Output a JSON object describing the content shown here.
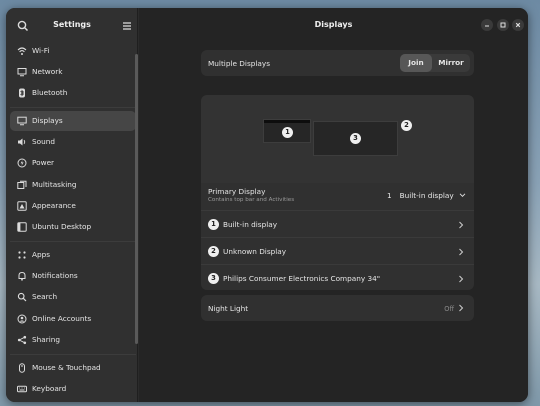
{
  "sidebar": {
    "title": "Settings",
    "items": [
      {
        "label": "Wi-Fi",
        "icon": "wifi-icon"
      },
      {
        "label": "Network",
        "icon": "network-icon"
      },
      {
        "label": "Bluetooth",
        "icon": "bluetooth-icon"
      },
      {
        "label": "Displays",
        "icon": "display-icon",
        "active": true
      },
      {
        "label": "Sound",
        "icon": "sound-icon"
      },
      {
        "label": "Power",
        "icon": "power-icon"
      },
      {
        "label": "Multitasking",
        "icon": "multitasking-icon"
      },
      {
        "label": "Appearance",
        "icon": "appearance-icon"
      },
      {
        "label": "Ubuntu Desktop",
        "icon": "ubuntu-desktop-icon"
      },
      {
        "label": "Apps",
        "icon": "apps-icon"
      },
      {
        "label": "Notifications",
        "icon": "notifications-icon"
      },
      {
        "label": "Search",
        "icon": "search-icon"
      },
      {
        "label": "Online Accounts",
        "icon": "online-accounts-icon"
      },
      {
        "label": "Sharing",
        "icon": "sharing-icon"
      },
      {
        "label": "Mouse & Touchpad",
        "icon": "mouse-icon"
      },
      {
        "label": "Keyboard",
        "icon": "keyboard-icon"
      }
    ]
  },
  "header": {
    "title": "Displays"
  },
  "multiple_displays": {
    "label": "Multiple Displays",
    "options": [
      "Join",
      "Mirror"
    ],
    "selected": "Join"
  },
  "arrangement": {
    "monitors": [
      "1",
      "3",
      "2"
    ]
  },
  "primary_display": {
    "title": "Primary Display",
    "subtitle": "Contains top bar and Activities",
    "number": "1",
    "value": "Built-in display"
  },
  "displays": [
    {
      "number": "1",
      "name": "Built-in display"
    },
    {
      "number": "2",
      "name": "Unknown Display"
    },
    {
      "number": "3",
      "name": "Philips Consumer Electronics Company 34\""
    }
  ],
  "night_light": {
    "label": "Night Light",
    "value": "Off"
  },
  "colors": {
    "accent": "#575757",
    "window_bg": "#242424",
    "sidebar_bg": "#303030"
  }
}
